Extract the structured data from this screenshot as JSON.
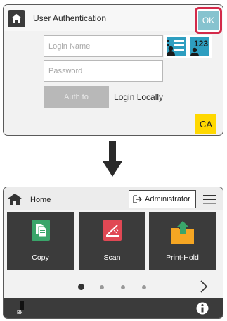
{
  "auth_screen": {
    "title": "User Authentication",
    "ok_label": "OK",
    "login_name_placeholder": "Login Name",
    "password_placeholder": "Password",
    "auth_to_label": "Auth to",
    "login_locally_label": "Login Locally",
    "ca_label": "CA",
    "icons": [
      "home-icon",
      "user-list-icon",
      "user-number-icon"
    ]
  },
  "home_screen": {
    "title": "Home",
    "admin_label": "Administrator",
    "tiles": [
      {
        "label": "Copy",
        "icon": "copy-icon"
      },
      {
        "label": "Scan",
        "icon": "scan-icon"
      },
      {
        "label": "Print-Hold",
        "icon": "print-hold-icon"
      }
    ],
    "page_indicator": {
      "current": 1,
      "total": 4
    },
    "toner_label": "Bk",
    "icons": [
      "home-icon",
      "logout-icon",
      "menu-icon",
      "chevron-right-icon",
      "info-icon"
    ]
  },
  "colors": {
    "ok_highlight": "#d32a4a",
    "ok_button": "#86c3cf",
    "ca_button": "#ffd800",
    "tile_bg": "#3b3b3b",
    "copy_green": "#3aa56a",
    "scan_red": "#e04854",
    "print_hold_orange": "#f5a623"
  }
}
